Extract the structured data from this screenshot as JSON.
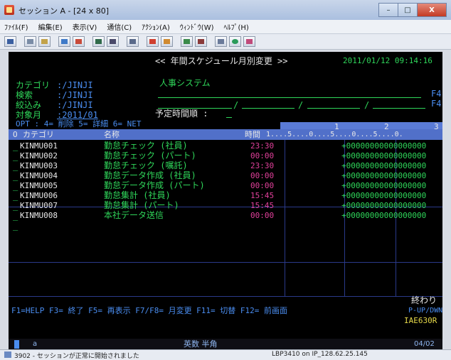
{
  "window": {
    "title": "セッション A - [24 x 80]",
    "buttons": [
      "–",
      "□",
      "X"
    ]
  },
  "menu": [
    "ﾌｧｲﾙ(F)",
    "編集(E)",
    "表示(V)",
    "通信(C)",
    "ｱｸｼｮﾝ(A)",
    "ｳｨﾝﾄﾞｳ(W)",
    "ﾍﾙﾌﾟ(H)"
  ],
  "screen": {
    "title": "<< 年間スケジュール月別変更 >>",
    "datetime": "2011/01/12 09:14:16",
    "fields": {
      "category_label": "カテゴリ",
      "category_value": ":/JINJI",
      "category_name": "人事システム",
      "search_label": "検索",
      "search_value": ":/JINJI",
      "filter_label": "絞込み",
      "filter_value": ":/JINJI",
      "target_label": "対象月",
      "target_value": ":2011/01",
      "planned_label": "予定時間順 :",
      "right_hint_1": "F4",
      "right_hint_2": "F4"
    },
    "opt_line": "OPT : 4= 削除 5= 詳細 6= NET",
    "ruler": {
      "top": [
        "1",
        "2",
        "3"
      ],
      "bottom": "1....5....0....5....0....5....0."
    },
    "columns": {
      "o": "O",
      "category": "カテゴリ",
      "name": "名称",
      "time": "時間"
    },
    "rows": [
      {
        "code": "KINMU001",
        "name": "勤怠チェック (社員)",
        "time": "23:30",
        "pattern": "+00000000000000000"
      },
      {
        "code": "KINMU002",
        "name": "勤怠チェック (パート)",
        "time": "00:00",
        "pattern": "+00000000000000000"
      },
      {
        "code": "KINMU003",
        "name": "勤怠チェック (嘱託)",
        "time": "23:30",
        "pattern": "+00000000000000000"
      },
      {
        "code": "KINMU004",
        "name": "勤怠データ作成 (社員)",
        "time": "00:00",
        "pattern": "+00000000000000000"
      },
      {
        "code": "KINMU005",
        "name": "勤怠データ作成 (パート)",
        "time": "00:00",
        "pattern": "+00000000000000000"
      },
      {
        "code": "KINMU006",
        "name": "勤怠集計 (社員)",
        "time": "15:45",
        "pattern": "+00000000000000000"
      },
      {
        "code": "KINMU007",
        "name": "勤怠集計 (パート)",
        "time": "15:45",
        "pattern": "+00000000000000000"
      },
      {
        "code": "KINMU008",
        "name": "本社データ送信",
        "time": "00:00",
        "pattern": "+00000000000000000"
      }
    ],
    "end_label": "終わり",
    "fkeys": "F1=HELP  F3= 終了  F5= 再表示  F7/F8= 月変更  F11= 切替  F12= 前画面",
    "fkeys_right": "P-UP/DWN",
    "screen_id": "IAE630R",
    "status_left": "a",
    "status_mid": "英数 半角",
    "status_right": "04/02"
  },
  "statusbar": {
    "message": "3902 - セッションが正常に開始されました",
    "connection": "LBP3410 on IP_128.62.25.145"
  }
}
